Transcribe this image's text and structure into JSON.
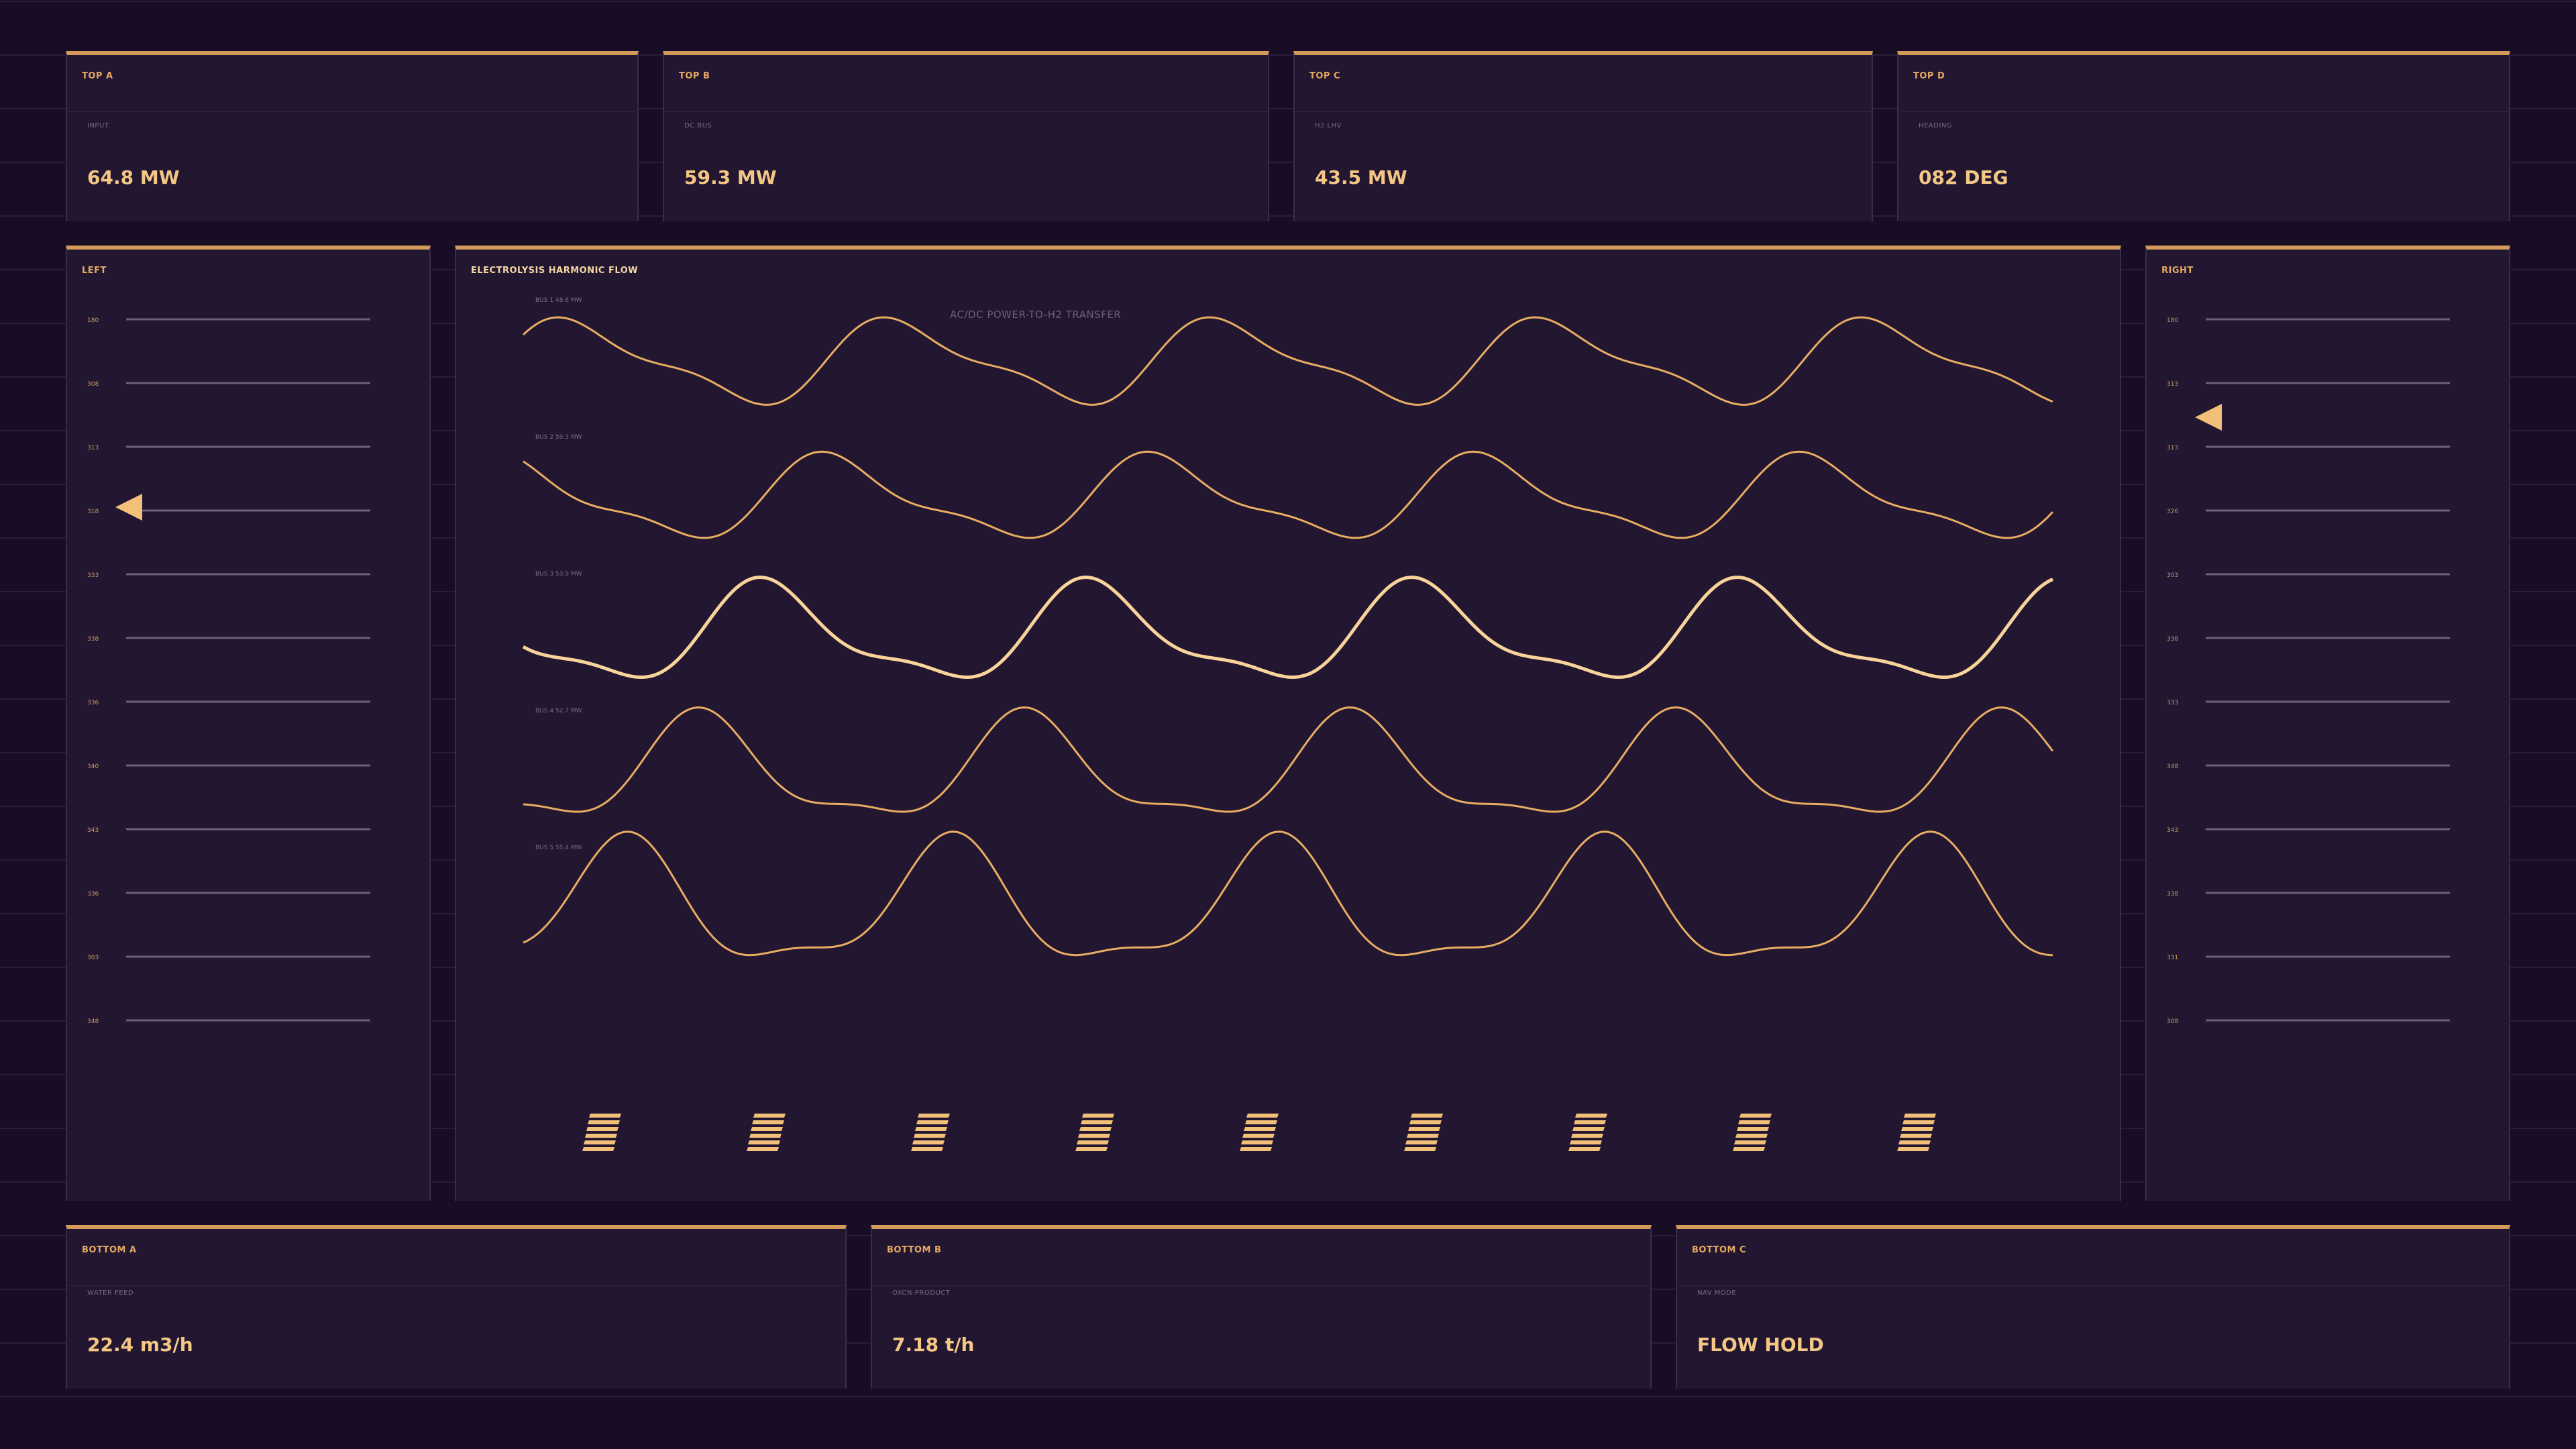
{
  "colors": {
    "background": "#180d24",
    "panel": "#231631",
    "accent": "#d49a5a",
    "value": "#f4c785",
    "trace": "#e8ad62",
    "muted": "#7a6a80"
  },
  "top_cards": [
    {
      "title": "TOP A",
      "sub": "INPUT",
      "value": "64.8 MW"
    },
    {
      "title": "TOP B",
      "sub": "DC BUS",
      "value": "59.3 MW"
    },
    {
      "title": "TOP C",
      "sub": "H2 LHV",
      "value": "43.5 MW"
    },
    {
      "title": "TOP D",
      "sub": "HEADING",
      "value": "082 DEG"
    }
  ],
  "left_panel": {
    "title": "LEFT",
    "ticks": [
      "180",
      "308",
      "313",
      "318",
      "333",
      "338",
      "336",
      "340",
      "343",
      "336",
      "303",
      "348"
    ]
  },
  "right_panel": {
    "title": "RIGHT",
    "ticks": [
      "180",
      "313",
      "313",
      "326",
      "303",
      "338",
      "333",
      "348",
      "343",
      "338",
      "331",
      "308"
    ]
  },
  "center": {
    "title": "ELECTROLYSIS HARMONIC FLOW",
    "subtitle": "AC/DC POWER-TO-H2 TRANSFER",
    "buses": [
      {
        "label": "BUS 1 48.6 MW"
      },
      {
        "label": "BUS 2 59.3 MW"
      },
      {
        "label": "BUS 3 53.9 MW"
      },
      {
        "label": "BUS 4 52.7 MW"
      },
      {
        "label": "BUS 5 55.4 MW"
      }
    ],
    "stack_count": 9
  },
  "bottom_cards": [
    {
      "title": "BOTTOM A",
      "sub": "WATER FEED",
      "value": "22.4 m3/h"
    },
    {
      "title": "BOTTOM B",
      "sub": "OXCN-PRODUCT",
      "value": "7.18 t/h"
    },
    {
      "title": "BOTTOM C",
      "sub": "NAV MODE",
      "value": "FLOW HOLD"
    }
  ]
}
